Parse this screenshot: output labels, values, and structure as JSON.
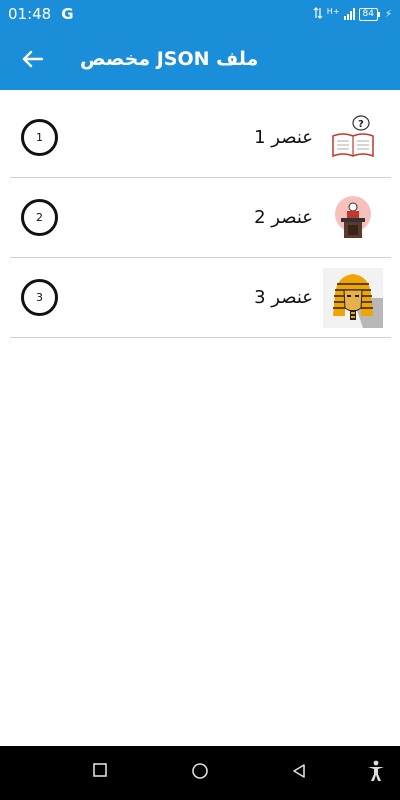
{
  "status_bar": {
    "time": "01:48",
    "g_logo": "G",
    "network": "H+",
    "battery": "84"
  },
  "app_bar": {
    "back_icon": "arrow-left-icon",
    "title": "ملف JSON مخصص"
  },
  "items": [
    {
      "number": "1",
      "label": "عنصر 1",
      "icon": "book-question-icon"
    },
    {
      "number": "2",
      "label": "عنصر 2",
      "icon": "speaker-podium-icon"
    },
    {
      "number": "3",
      "label": "عنصر 3",
      "icon": "pharaoh-mask-icon"
    }
  ],
  "nav_bar": {
    "recents_icon": "square-icon",
    "home_icon": "circle-icon",
    "back_icon": "triangle-back-icon",
    "accessibility_icon": "accessibility-icon"
  },
  "colors": {
    "primary": "#1a8ed8",
    "divider": "#cfcfcf",
    "nav": "#000000"
  }
}
